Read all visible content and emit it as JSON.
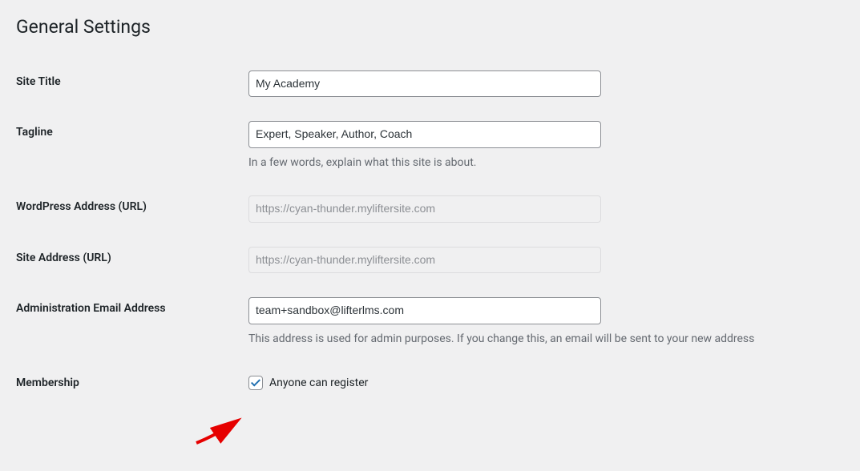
{
  "page_title": "General Settings",
  "fields": {
    "site_title": {
      "label": "Site Title",
      "value": "My Academy"
    },
    "tagline": {
      "label": "Tagline",
      "value": "Expert, Speaker, Author, Coach",
      "description": "In a few words, explain what this site is about."
    },
    "wp_url": {
      "label": "WordPress Address (URL)",
      "value": "https://cyan-thunder.myliftersite.com",
      "disabled": true
    },
    "site_url": {
      "label": "Site Address (URL)",
      "value": "https://cyan-thunder.myliftersite.com",
      "disabled": true
    },
    "admin_email": {
      "label": "Administration Email Address",
      "value": "team+sandbox@lifterlms.com",
      "description": "This address is used for admin purposes. If you change this, an email will be sent to your new address"
    },
    "membership": {
      "label": "Membership",
      "checkbox_label": "Anyone can register",
      "checked": true
    }
  }
}
